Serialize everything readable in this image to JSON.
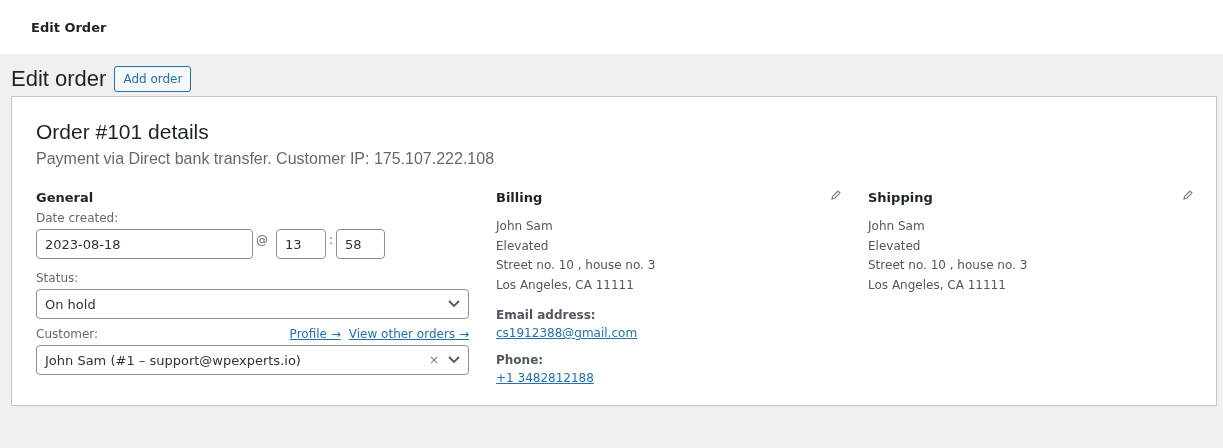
{
  "topbar": {
    "title": "Edit Order"
  },
  "heading": {
    "title": "Edit order",
    "action": "Add order"
  },
  "order": {
    "title": "Order #101 details",
    "subtitle": "Payment via Direct bank transfer. Customer IP: 175.107.222.108"
  },
  "general": {
    "title": "General",
    "date_label": "Date created:",
    "date": "2023-08-18",
    "at": "@",
    "hour": "13",
    "colon": ":",
    "minute": "58",
    "status_label": "Status:",
    "status": "On hold",
    "customer_label": "Customer:",
    "customer_links": [
      "Profile →",
      "View other orders →"
    ],
    "customer": "John Sam (#1 – support@wpexperts.io)",
    "clear": "×"
  },
  "billing": {
    "title": "Billing",
    "address": [
      "John Sam",
      "Elevated",
      "Street no. 10 , house no. 3",
      "Los Angeles, CA 11111"
    ],
    "contacts": [
      {
        "label": "Email address:",
        "value": "cs1912388@gmail.com"
      },
      {
        "label": "Phone:",
        "value": "+1 3482812188"
      }
    ]
  },
  "shipping": {
    "title": "Shipping",
    "address": [
      "John Sam",
      "Elevated",
      "Street no. 10 , house no. 3",
      "Los Angeles, CA 11111"
    ]
  }
}
